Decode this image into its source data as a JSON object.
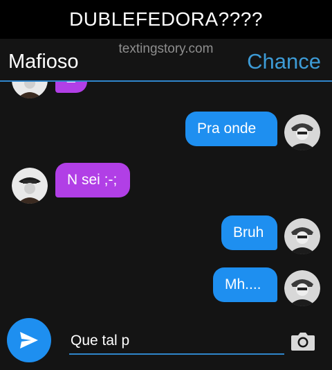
{
  "banner": {
    "title": "DUBLEFEDORA????"
  },
  "header": {
    "contact_left": "Mafioso",
    "watermark": "textingstory.com",
    "contact_right": "Chance"
  },
  "messages": [
    {
      "side": "left",
      "text": "_"
    },
    {
      "side": "right",
      "text": "Pra onde"
    },
    {
      "side": "left",
      "text": "N sei ;-;"
    },
    {
      "side": "right",
      "text": "Bruh"
    },
    {
      "side": "right",
      "text": "Mh...."
    }
  ],
  "composer": {
    "value": "Que tal p"
  },
  "icons": {
    "send": "send-icon",
    "camera": "camera-icon",
    "avatar_left": "avatar-mafioso",
    "avatar_right": "avatar-chance"
  },
  "colors": {
    "left_bubble": "#b13fe6",
    "right_bubble": "#1e8ff0",
    "accent": "#2f86cc",
    "contact_right": "#3d9bd6"
  }
}
